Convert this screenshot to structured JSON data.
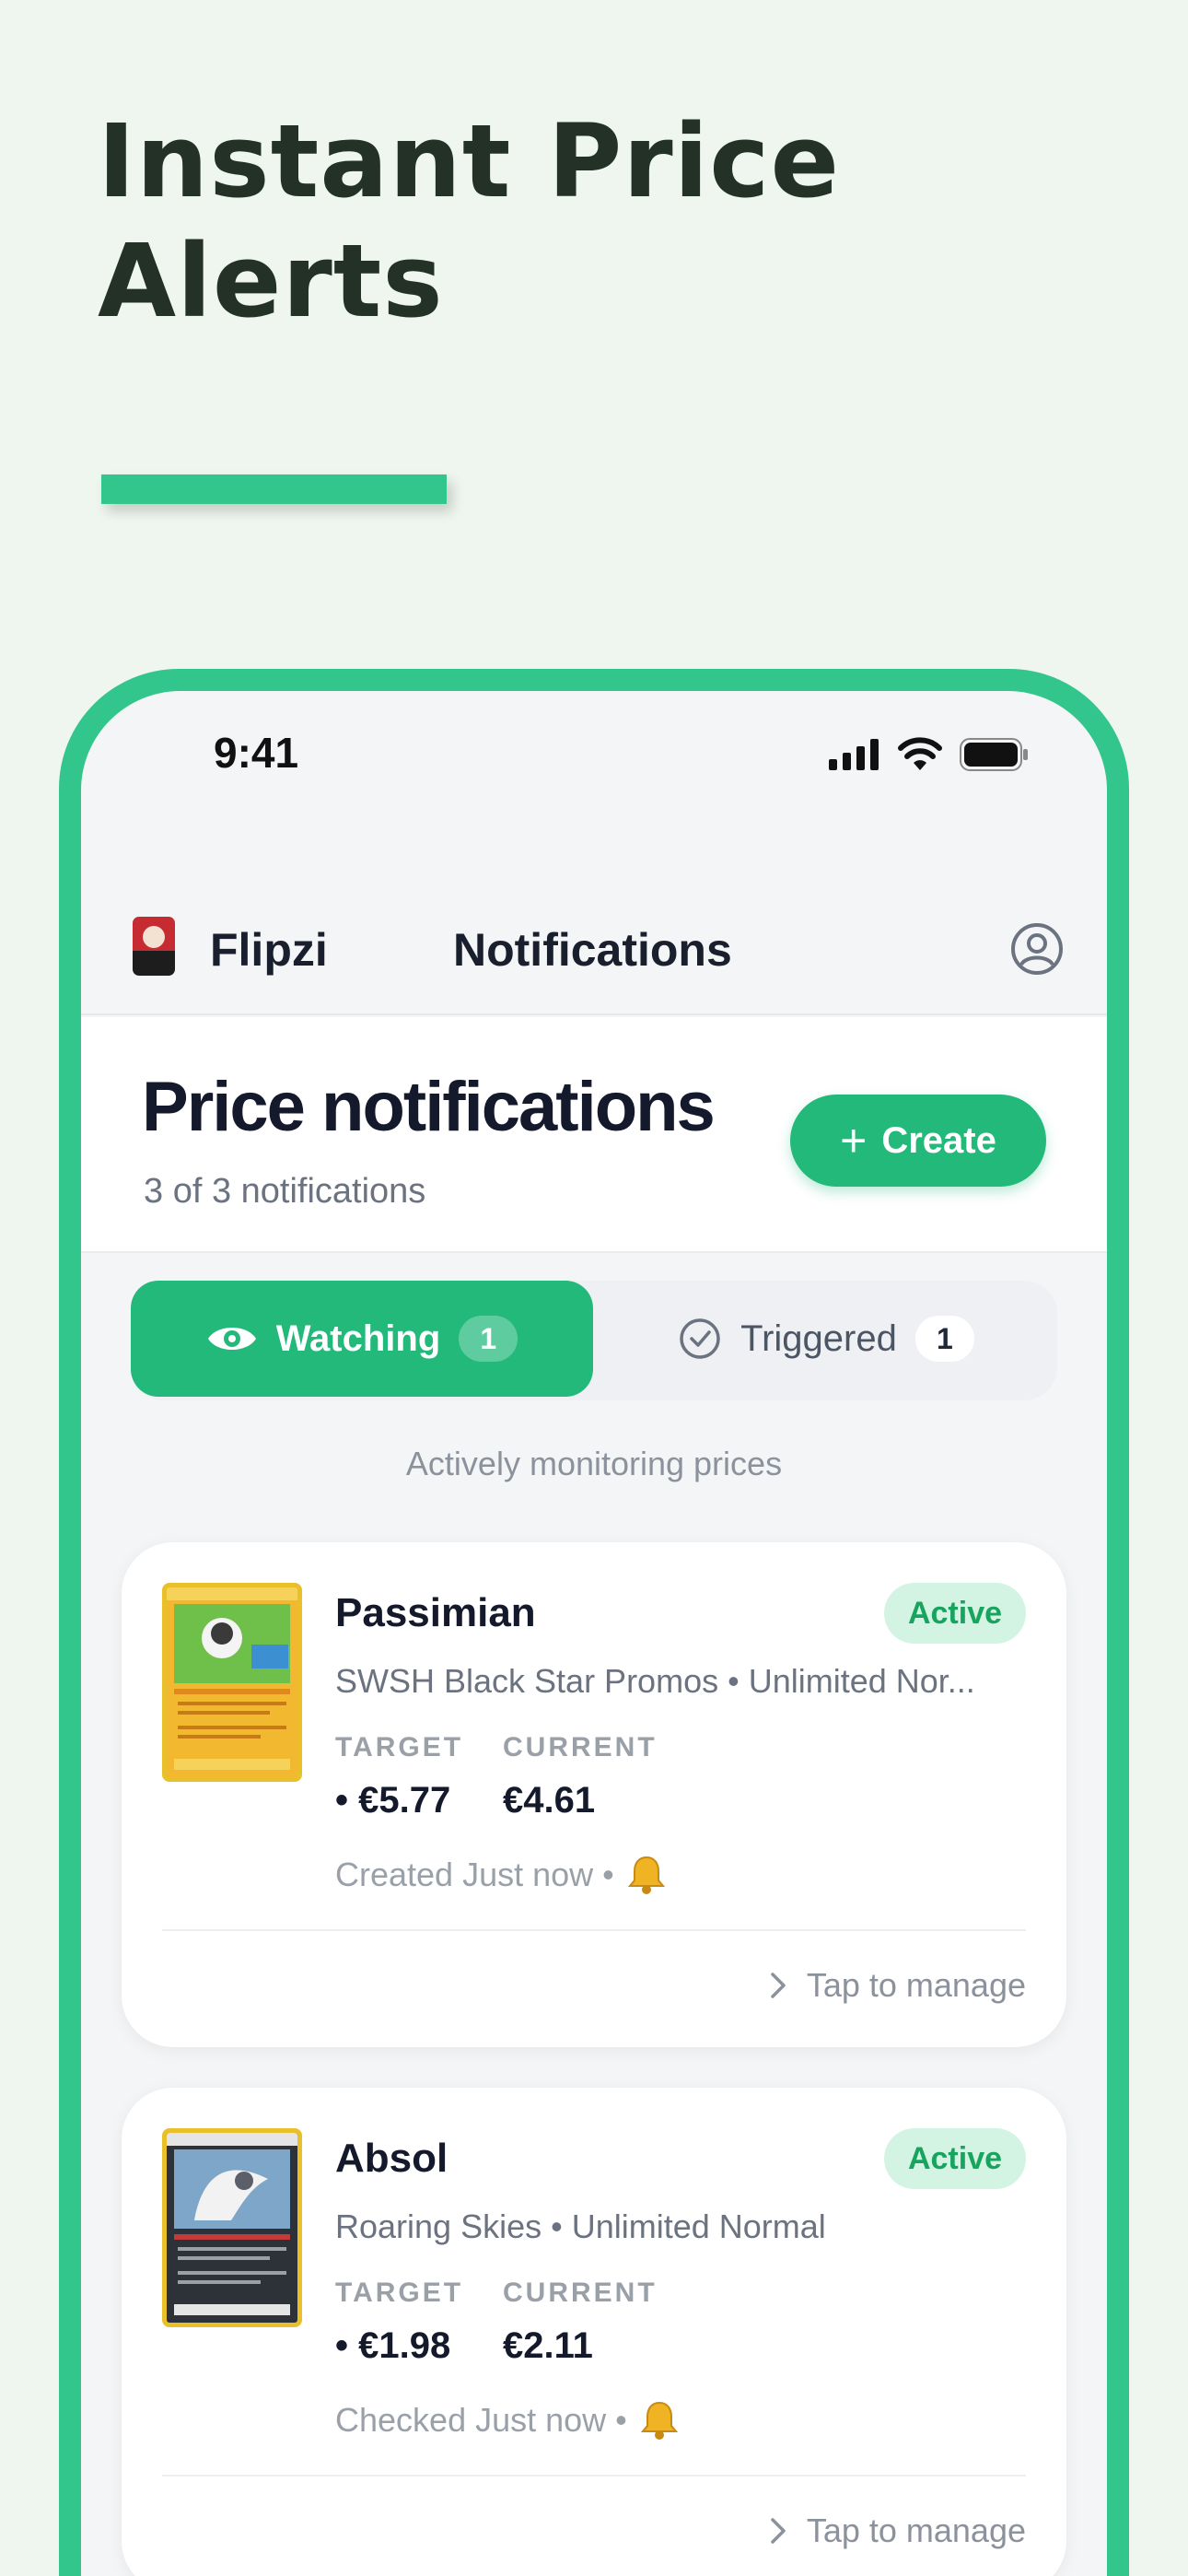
{
  "promo": {
    "headline": "Instant Price Alerts"
  },
  "status_bar": {
    "time": "9:41"
  },
  "header": {
    "brand": "Flipzi",
    "title": "Notifications"
  },
  "page": {
    "title": "Price notifications",
    "subtitle": "3 of 3 notifications",
    "create_label": "Create"
  },
  "tabs": {
    "watching_label": "Watching",
    "watching_count": "1",
    "triggered_label": "Triggered",
    "triggered_count": "1",
    "hint": "Actively monitoring prices"
  },
  "colors": {
    "accent": "#22b97b",
    "frame": "#33c68c",
    "background": "#eff6ef",
    "badge_bg": "#d3f4e2",
    "badge_text": "#16a45f"
  },
  "cards": [
    {
      "name": "Passimian",
      "status": "Active",
      "set": "SWSH Black Star Promos • Unlimited Nor...",
      "target_label": "TARGET",
      "current_label": "CURRENT",
      "target": "• €5.77",
      "current": "€4.61",
      "meta": "Created Just now •",
      "manage": "Tap to manage"
    },
    {
      "name": "Absol",
      "status": "Active",
      "set": "Roaring Skies • Unlimited Normal",
      "target_label": "TARGET",
      "current_label": "CURRENT",
      "target": "• €1.98",
      "current": "€2.11",
      "meta": "Checked Just now •",
      "manage": "Tap to manage"
    }
  ],
  "icons": [
    "signal-icon",
    "wifi-icon",
    "battery-icon",
    "profile-icon",
    "plus-icon",
    "eye-icon",
    "check-circle-icon",
    "bell-icon",
    "chevron-right-icon"
  ]
}
